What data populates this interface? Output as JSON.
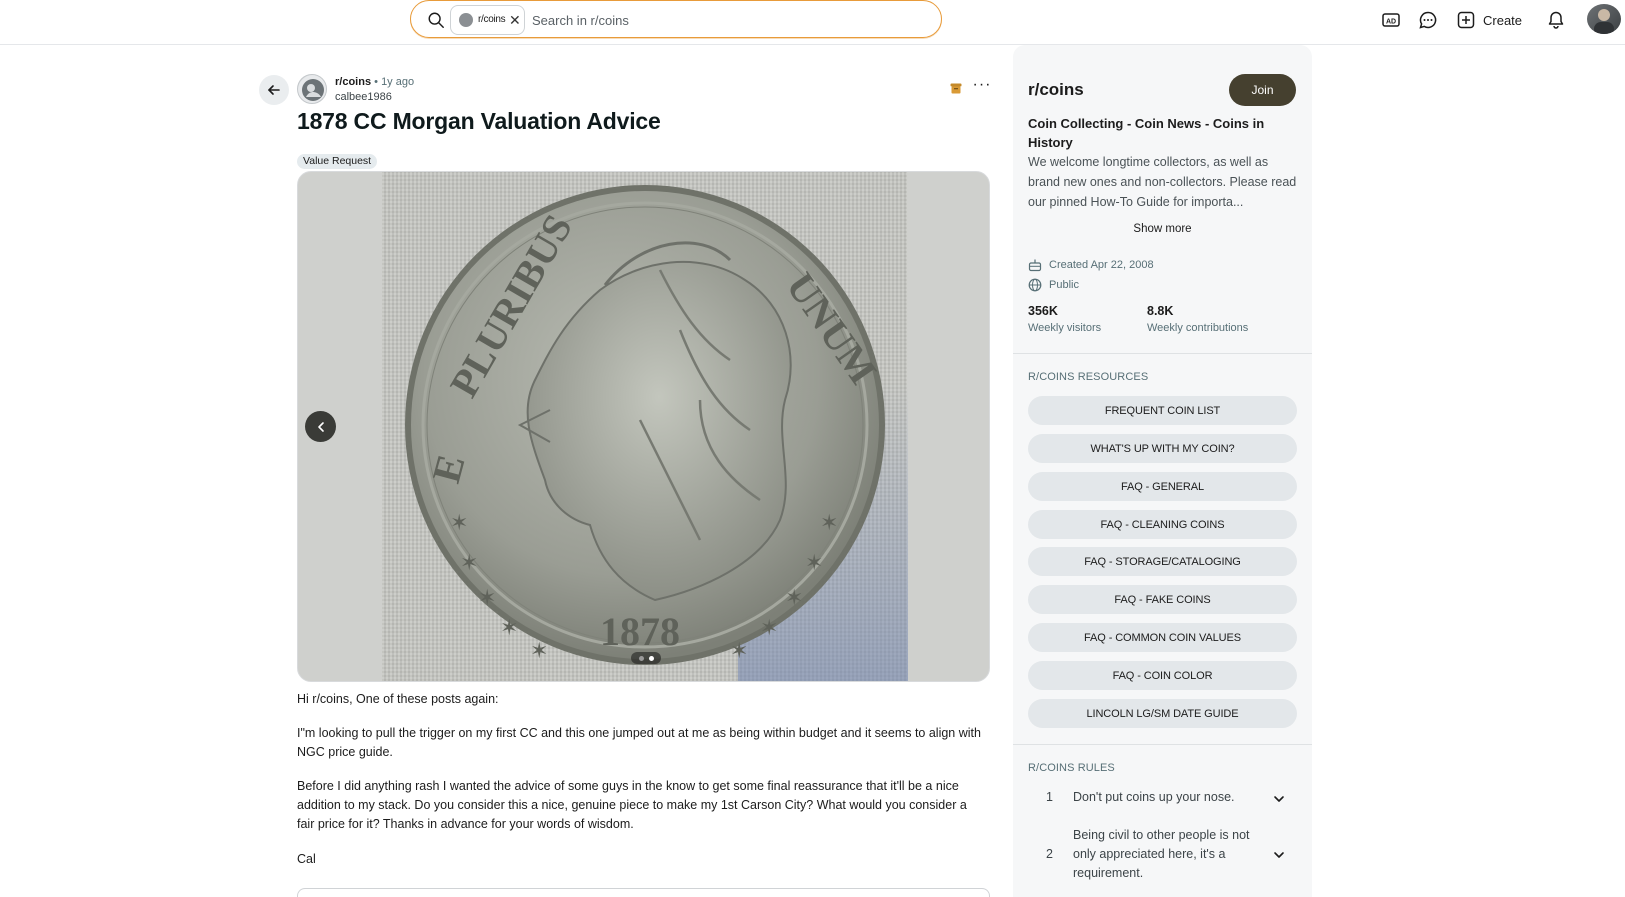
{
  "header": {
    "search": {
      "chip_label": "r/coins",
      "placeholder": "Search in r/coins"
    },
    "create_label": "Create",
    "icons": [
      "search-icon",
      "ad-icon",
      "chat-icon",
      "plus-icon",
      "bell-icon",
      "avatar"
    ]
  },
  "post": {
    "subreddit": "r/coins",
    "separator": "•",
    "age": "1y ago",
    "author": "calbee1986",
    "title": "1878 CC Morgan Valuation Advice",
    "flair": "Value Request",
    "gallery": {
      "total_images": 2,
      "current_index": 2
    },
    "body": [
      "Hi r/coins, One of these posts again:",
      "I\"m looking to pull the trigger on my first CC and this one jumped out at me as being within budget and it seems to align with NGC price guide.",
      "Before I did anything rash I wanted the advice of some guys in the know to get some final reassurance that it'll be a nice addition to my stack. Do you consider this a nice, genuine piece to make my 1st Carson City? What would you consider a fair price for it? Thanks in advance for your words of wisdom.",
      "Cal"
    ]
  },
  "sidebar": {
    "name": "r/coins",
    "join_label": "Join",
    "heading": "Coin Collecting - Coin News - Coins in History",
    "description": "We welcome longtime collectors, as well as brand new ones and non-collectors. Please read our pinned How-To Guide for importa...",
    "show_more": "Show more",
    "created": "Created Apr 22, 2008",
    "visibility": "Public",
    "stats": [
      {
        "value": "356K",
        "label": "Weekly visitors"
      },
      {
        "value": "8.8K",
        "label": "Weekly contributions"
      }
    ],
    "resources_title": "R/COINS RESOURCES",
    "resources": [
      "FREQUENT COIN LIST",
      "WHAT'S UP WITH MY COIN?",
      "FAQ - GENERAL",
      "FAQ - CLEANING COINS",
      "FAQ - STORAGE/CATALOGING",
      "FAQ - FAKE COINS",
      "FAQ - COMMON COIN VALUES",
      "FAQ - COIN COLOR",
      "LINCOLN LG/SM DATE GUIDE"
    ],
    "rules_title": "R/COINS RULES",
    "rules": [
      {
        "num": "1",
        "text": "Don't put coins up your nose."
      },
      {
        "num": "2",
        "text": "Being civil to other people is not only appreciated here, it's a requirement."
      }
    ]
  }
}
